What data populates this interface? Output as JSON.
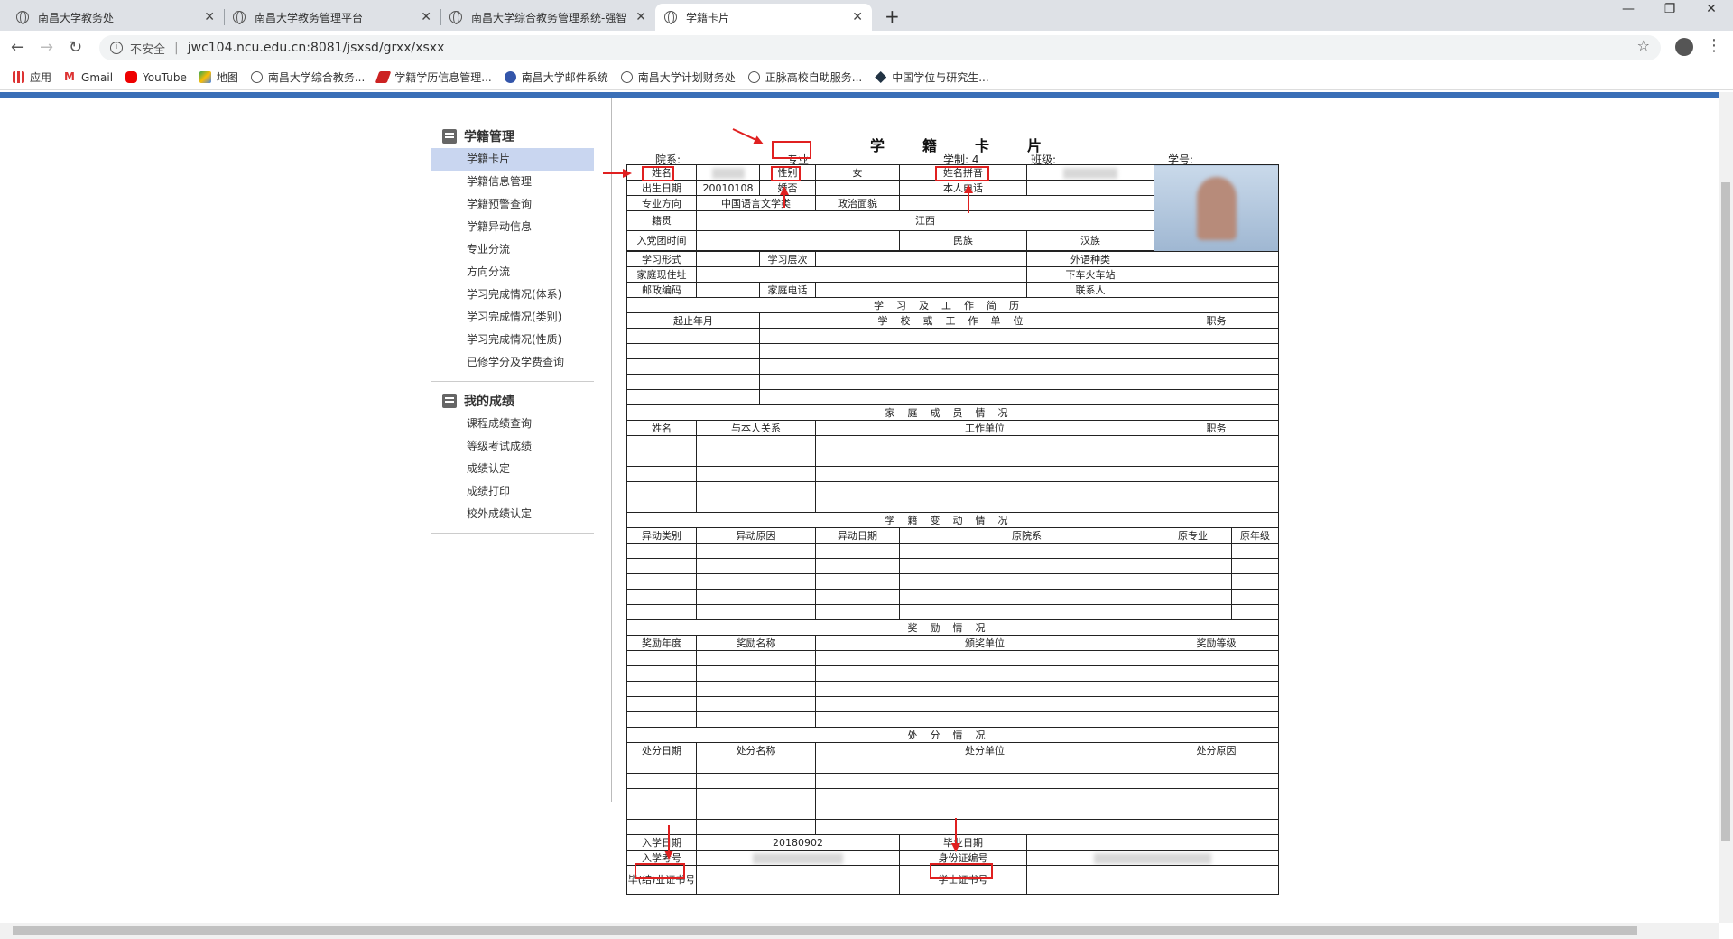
{
  "browser": {
    "tabs": [
      {
        "title": "南昌大学教务处"
      },
      {
        "title": "南昌大学教务管理平台"
      },
      {
        "title": "南昌大学综合教务管理系统-强智"
      },
      {
        "title": "学籍卡片"
      }
    ],
    "address": {
      "security": "不安全",
      "url": "jwc104.ncu.edu.cn:8081/jsxsd/grxx/xsxx"
    },
    "bookmarks": [
      "应用",
      "Gmail",
      "YouTube",
      "地图",
      "南昌大学综合教务...",
      "学籍学历信息管理...",
      "南昌大学邮件系统",
      "南昌大学计划财务处",
      "正脉高校自助服务...",
      "中国学位与研究生..."
    ]
  },
  "sidebar": {
    "section1": {
      "title": "学籍管理",
      "items": [
        "学籍卡片",
        "学籍信息管理",
        "学籍预警查询",
        "学籍异动信息",
        "专业分流",
        "方向分流",
        "学习完成情况(体系)",
        "学习完成情况(类别)",
        "学习完成情况(性质)",
        "已修学分及学费查询"
      ]
    },
    "section2": {
      "title": "我的成绩",
      "items": [
        "课程成绩查询",
        "等级考试成绩",
        "成绩认定",
        "成绩打印",
        "校外成绩认定"
      ]
    }
  },
  "card": {
    "title": "学籍卡片",
    "header": {
      "dept": "院系:",
      "major": "专业",
      "years": "学制: 4",
      "class": "班级:",
      "sid": "学号:"
    },
    "labels": {
      "name": "姓名",
      "gender": "性别",
      "gender_value": "女",
      "pinyin": "姓名拼音",
      "birth": "出生日期",
      "birth_value": "20010108",
      "married": "婚否",
      "phone": "本人电话",
      "direction": "专业方向",
      "direction_value": "中国语言文学类",
      "political": "政治面貌",
      "native": "籍贯",
      "native_value": "江西",
      "party": "入党团时间",
      "nation": "民族",
      "nation_value": "汉族",
      "study_form": "学习形式",
      "study_level": "学习层次",
      "lang": "外语种类",
      "address": "家庭现住址",
      "station": "下车火车站",
      "postcode": "邮政编码",
      "home_phone": "家庭电话",
      "contact": "联系人",
      "resume_title": "学习及工作简历",
      "period": "起止年月",
      "unit": "学校或工作单位",
      "post": "职务",
      "family_title": "家庭成员情况",
      "fname": "姓名",
      "relation": "与本人关系",
      "work_unit": "工作单位",
      "fpost": "职务",
      "change_title": "学籍变动情况",
      "change_type": "异动类别",
      "change_reason": "异动原因",
      "change_date": "异动日期",
      "orig_dept": "原院系",
      "orig_major": "原专业",
      "orig_grade": "原年级",
      "award_title": "奖励情况",
      "award_year": "奖励年度",
      "award_name": "奖励名称",
      "award_unit": "颁奖单位",
      "award_level": "奖励等级",
      "punish_title": "处分情况",
      "punish_date": "处分日期",
      "punish_name": "处分名称",
      "punish_unit": "处分单位",
      "punish_reason": "处分原因",
      "enroll_date": "入学日期",
      "enroll_date_value": "20180902",
      "grad_date": "毕业日期",
      "exam_no": "入学考号",
      "id_no": "身份证编号",
      "diploma_no": "毕(结)业证书号",
      "degree_no": "学士证书号"
    }
  },
  "colors": {
    "accent": "#3a6fb7",
    "annotation": "#e02020",
    "sidebar_active": "#c9d6f0"
  }
}
